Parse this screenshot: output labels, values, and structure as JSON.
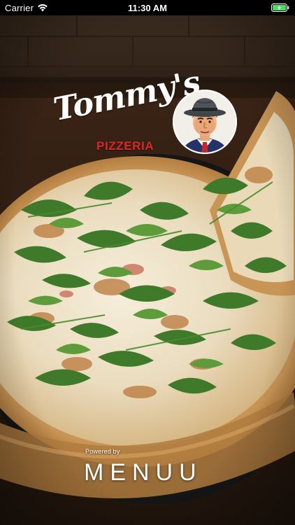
{
  "status_bar": {
    "carrier": "Carrier",
    "time": "11:30 AM",
    "wifi_icon": "wifi-icon",
    "battery_icon": "battery-charging-icon",
    "battery_color": "#4cd964"
  },
  "splash": {
    "brand_script": "Tommy's",
    "brand_sub": "PIZZERIA",
    "brand_sub_color": "#e0262a",
    "mascot_icon": "mascot-portrait-icon",
    "background_image": "pizza-photo",
    "powered_by_label": "Powered by",
    "platform_logo_text": "MENUU"
  }
}
